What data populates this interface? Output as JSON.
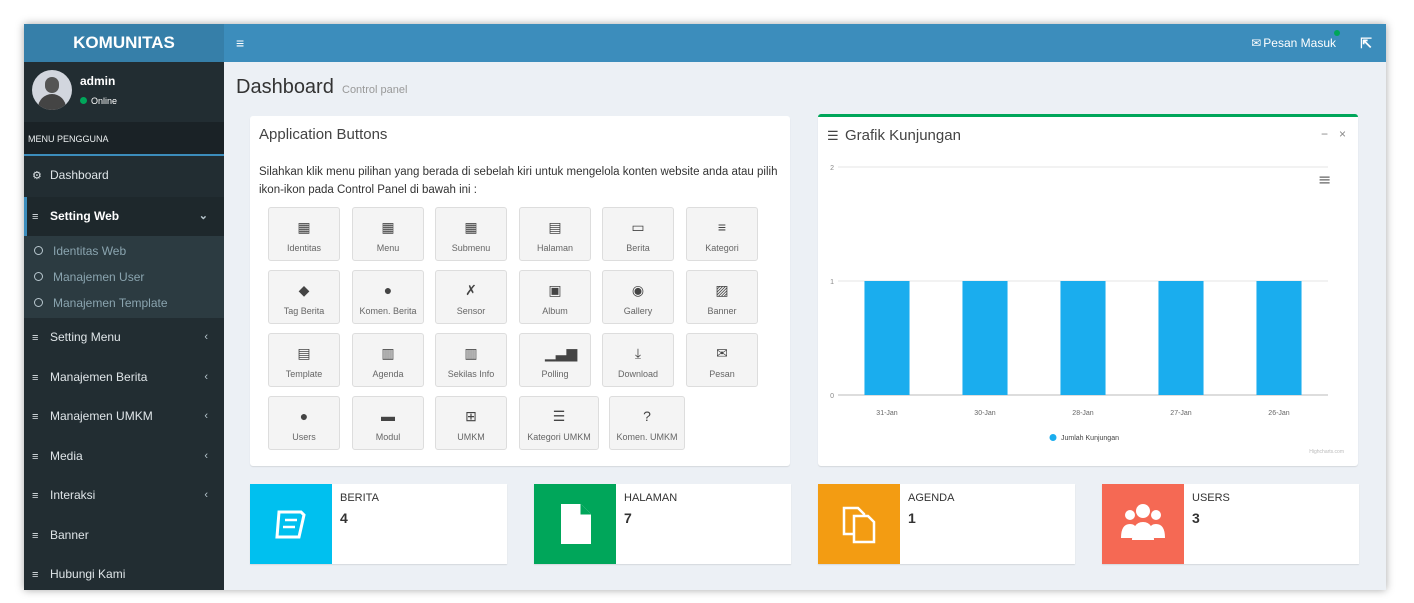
{
  "topbar": {
    "logo": "KOMUNITAS",
    "menu_toggle": "≡",
    "messages_label": "Pesan Masuk"
  },
  "user": {
    "name": "admin",
    "status": "Online"
  },
  "sidebar": {
    "header": "MENU PENGGUNA",
    "items": [
      {
        "label": "Dashboard",
        "icon": "dashboard-icon",
        "glyph": "⚙"
      },
      {
        "label": "Setting Web",
        "icon": "list-icon",
        "glyph": "≡",
        "expanded": true
      },
      {
        "label": "Setting Menu",
        "icon": "list-icon",
        "glyph": "≡"
      },
      {
        "label": "Manajemen Berita",
        "icon": "list-icon",
        "glyph": "≡"
      },
      {
        "label": "Manajemen UMKM",
        "icon": "list-icon",
        "glyph": "≡"
      },
      {
        "label": "Media",
        "icon": "list-icon",
        "glyph": "≡"
      },
      {
        "label": "Interaksi",
        "icon": "list-icon",
        "glyph": "≡"
      },
      {
        "label": "Banner",
        "icon": "list-icon",
        "glyph": "≡"
      },
      {
        "label": "Hubungi Kami",
        "icon": "list-icon",
        "glyph": "≡"
      }
    ],
    "subitems": [
      "Identitas Web",
      "Manajemen User",
      "Manajemen Template"
    ]
  },
  "page": {
    "title": "Dashboard",
    "subtitle": "Control panel"
  },
  "app_buttons": {
    "title": "Application Buttons",
    "intro": "Silahkan klik menu pilihan yang berada di sebelah kiri untuk mengelola konten website anda atau pilih ikon-ikon pada Control Panel di bawah ini :",
    "rows": [
      [
        {
          "label": "Identitas",
          "icon": "grid-icon",
          "glyph": "▦"
        },
        {
          "label": "Menu",
          "icon": "grid-large-icon",
          "glyph": "▦"
        },
        {
          "label": "Submenu",
          "icon": "grid-icon",
          "glyph": "▦"
        },
        {
          "label": "Halaman",
          "icon": "file-icon",
          "glyph": "▤"
        },
        {
          "label": "Berita",
          "icon": "monitor-icon",
          "glyph": "▭"
        },
        {
          "label": "Kategori",
          "icon": "bars-icon",
          "glyph": "≡"
        }
      ],
      [
        {
          "label": "Tag Berita",
          "icon": "tag-icon",
          "glyph": "◆"
        },
        {
          "label": "Komen. Berita",
          "icon": "comments-icon",
          "glyph": "●"
        },
        {
          "label": "Sensor",
          "icon": "mute-icon",
          "glyph": "✗"
        },
        {
          "label": "Album",
          "icon": "image-icon",
          "glyph": "▣"
        },
        {
          "label": "Gallery",
          "icon": "camera-icon",
          "glyph": "◉"
        },
        {
          "label": "Banner",
          "icon": "picture-icon",
          "glyph": "▨"
        }
      ],
      [
        {
          "label": "Template",
          "icon": "file-icon",
          "glyph": "▤"
        },
        {
          "label": "Agenda",
          "icon": "calendar-icon",
          "glyph": "▥"
        },
        {
          "label": "Sekilas Info",
          "icon": "calendar-icon",
          "glyph": "▥"
        },
        {
          "label": "Polling",
          "icon": "bar-chart-icon",
          "glyph": "▁▃▆"
        },
        {
          "label": "Download",
          "icon": "download-icon",
          "glyph": "⤓"
        },
        {
          "label": "Pesan",
          "icon": "envelope-icon",
          "glyph": "✉"
        }
      ],
      [
        {
          "label": "Users",
          "icon": "users-icon",
          "glyph": "●"
        },
        {
          "label": "Modul",
          "icon": "folder-icon",
          "glyph": "▬"
        },
        {
          "label": "UMKM",
          "icon": "cart-icon",
          "glyph": "⊞"
        },
        {
          "label": "Kategori UMKM",
          "icon": "list-icon",
          "glyph": "☰"
        },
        {
          "label": "Komen. UMKM",
          "icon": "question-icon",
          "glyph": "?"
        }
      ]
    ]
  },
  "chart_box": {
    "title": "Grafik Kunjungan",
    "icon": "list-icon",
    "minimize": "−",
    "close": "×",
    "menu": "≡",
    "credit": "Highcharts.com"
  },
  "chart_data": {
    "type": "bar",
    "categories": [
      "31-Jan",
      "30-Jan",
      "28-Jan",
      "27-Jan",
      "26-Jan"
    ],
    "series": [
      {
        "name": "Jumlah Kunjungan",
        "values": [
          1,
          1,
          1,
          1,
          1
        ],
        "color": "#1aadee"
      }
    ],
    "ylim": [
      0,
      2
    ],
    "yticks": [
      0,
      1,
      2
    ],
    "grid": true,
    "legend": "bottom-center"
  },
  "info_boxes": [
    {
      "label": "BERITA",
      "value": "4",
      "color": "#00c0ef",
      "icon": "book-icon"
    },
    {
      "label": "HALAMAN",
      "value": "7",
      "color": "#00a65a",
      "icon": "file-icon"
    },
    {
      "label": "AGENDA",
      "value": "1",
      "color": "#f39c12",
      "icon": "copy-icon"
    },
    {
      "label": "USERS",
      "value": "3",
      "color": "#f56954",
      "icon": "users-icon"
    }
  ]
}
